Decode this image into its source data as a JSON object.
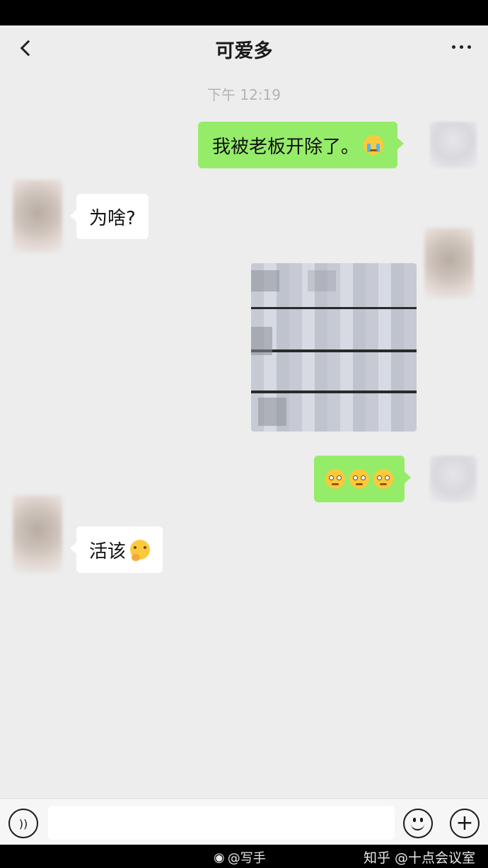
{
  "header": {
    "title": "可爱多",
    "back_icon": "chevron-left-icon",
    "more_icon": "more-dots-icon"
  },
  "timestamp": "下午 12:19",
  "messages": [
    {
      "side": "right",
      "text": "我被老板开除了。",
      "emoji": "loudly-crying-face"
    },
    {
      "side": "left",
      "text": "为啥?"
    },
    {
      "side": "right",
      "type": "image",
      "content": "pixelated-screenshot"
    },
    {
      "side": "right",
      "emoji_count": 3,
      "emoji": "flushed-face"
    },
    {
      "side": "left",
      "text": "活该",
      "emoji": "face-with-hand-over-mouth"
    }
  ],
  "input_bar": {
    "voice_icon": "voice-icon",
    "emoji_icon": "smiley-icon",
    "plus_icon": "plus-icon",
    "placeholder": ""
  },
  "watermark": {
    "left": "@写手",
    "right": "知乎 @十点会议室"
  }
}
